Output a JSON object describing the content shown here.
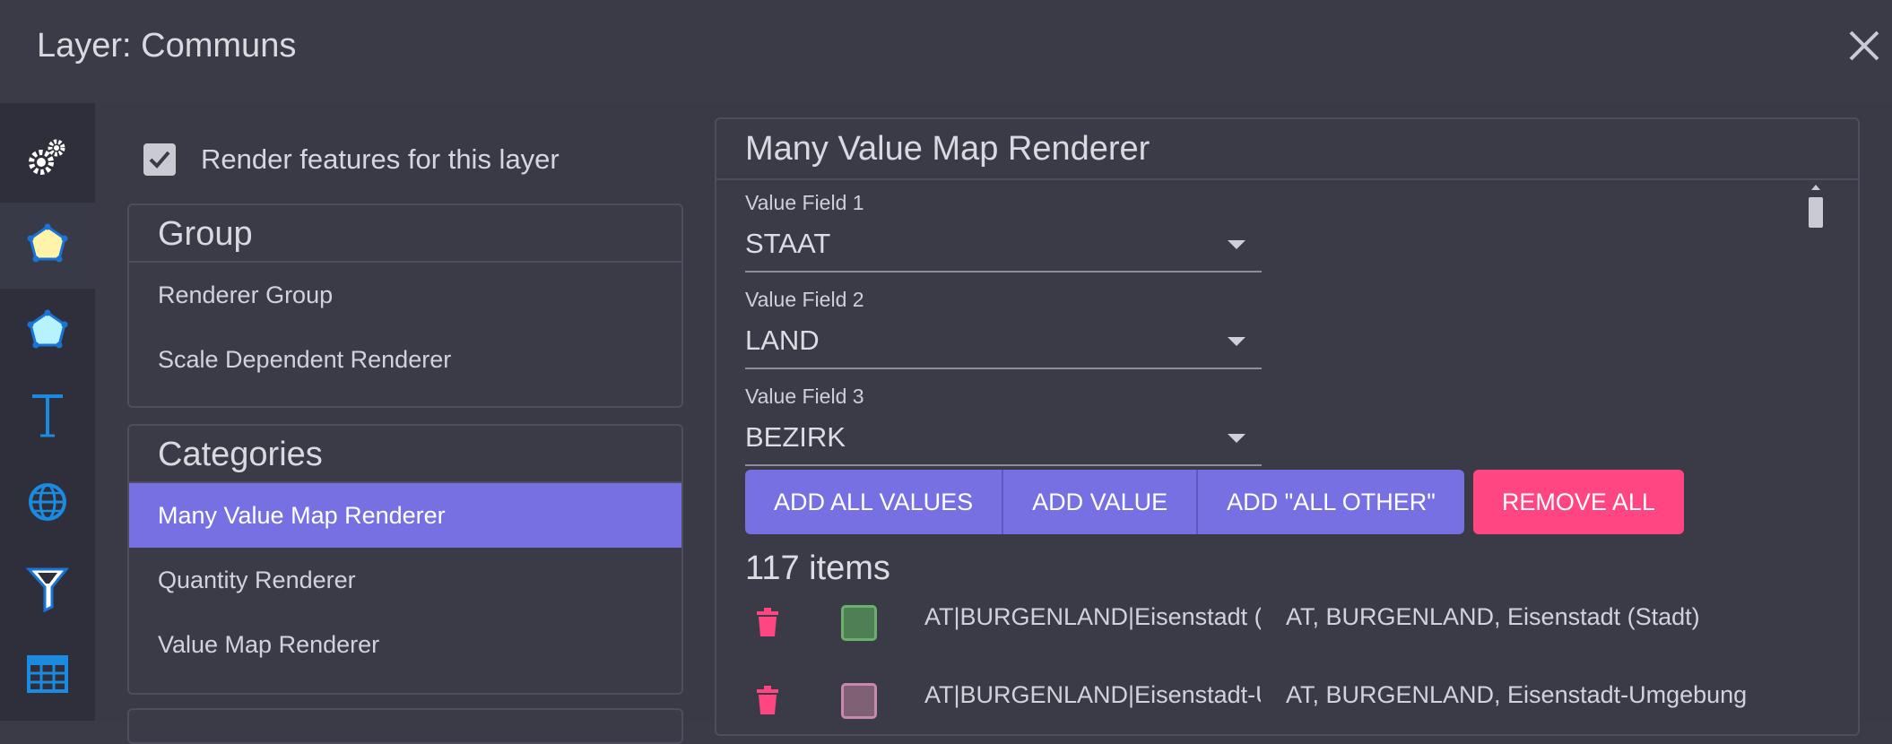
{
  "window": {
    "title": "Layer: Communs"
  },
  "sidebar": {
    "items": [
      {
        "icon": "gears-icon"
      },
      {
        "icon": "polygon-yellow-icon",
        "active": true
      },
      {
        "icon": "polygon-cyan-icon"
      },
      {
        "icon": "text-icon"
      },
      {
        "icon": "globe-icon"
      },
      {
        "icon": "filter-icon"
      },
      {
        "icon": "table-icon"
      }
    ]
  },
  "render_checkbox": {
    "label": "Render features for this layer",
    "checked": true
  },
  "group_panel": {
    "title": "Group",
    "items": [
      "Renderer Group",
      "Scale Dependent Renderer"
    ]
  },
  "categories_panel": {
    "title": "Categories",
    "items": [
      "Many Value Map Renderer",
      "Quantity Renderer",
      "Value Map Renderer"
    ],
    "selected": "Many Value Map Renderer"
  },
  "renderer": {
    "title": "Many Value Map Renderer",
    "fields": [
      {
        "label": "Value Field 1",
        "value": "STAAT"
      },
      {
        "label": "Value Field 2",
        "value": "LAND"
      },
      {
        "label": "Value Field 3",
        "value": "BEZIRK"
      }
    ],
    "buttons": {
      "add_all": "ADD ALL VALUES",
      "add_value": "ADD VALUE",
      "add_all_other": "ADD \"ALL OTHER\"",
      "remove_all": "REMOVE ALL"
    },
    "count_label": "117 items",
    "rows": [
      {
        "key": "AT|BURGENLAND|Eisenstadt (Stadt)",
        "label": "AT, BURGENLAND, Eisenstadt (Stadt)",
        "fill": "#4e7f55",
        "stroke": "#6ab06a"
      },
      {
        "key": "AT|BURGENLAND|Eisenstadt-Umgebung",
        "label": "AT, BURGENLAND, Eisenstadt-Umgebung",
        "fill": "#7e6173",
        "stroke": "#c888b0"
      }
    ]
  },
  "colors": {
    "accent": "#7770e3",
    "danger": "#ff4582",
    "background": "#393a46"
  }
}
